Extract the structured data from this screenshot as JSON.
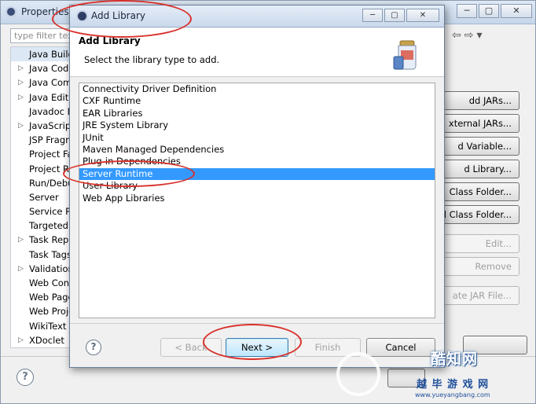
{
  "background_window": {
    "title": "Properties f",
    "filter_placeholder": "type filter tex",
    "tree_items": [
      {
        "label": "Java Build",
        "arrow": ""
      },
      {
        "label": "Java Code",
        "arrow": "▷"
      },
      {
        "label": "Java Comp",
        "arrow": "▷"
      },
      {
        "label": "Java Edito",
        "arrow": "▷"
      },
      {
        "label": "Javadoc Lo",
        "arrow": ""
      },
      {
        "label": "JavaScript",
        "arrow": "▷"
      },
      {
        "label": "JSP Fragm",
        "arrow": ""
      },
      {
        "label": "Project Fa",
        "arrow": ""
      },
      {
        "label": "Project Re",
        "arrow": ""
      },
      {
        "label": "Run/Debu",
        "arrow": ""
      },
      {
        "label": "Server",
        "arrow": ""
      },
      {
        "label": "Service Po",
        "arrow": ""
      },
      {
        "label": "Targeted",
        "arrow": ""
      },
      {
        "label": "Task Repo",
        "arrow": "▷"
      },
      {
        "label": "Task Tags",
        "arrow": ""
      },
      {
        "label": "Validation",
        "arrow": "▷"
      },
      {
        "label": "Web Cont",
        "arrow": ""
      },
      {
        "label": "Web Page",
        "arrow": ""
      },
      {
        "label": "Web Proje",
        "arrow": ""
      },
      {
        "label": "WikiText",
        "arrow": ""
      },
      {
        "label": "XDoclet",
        "arrow": "▷"
      }
    ],
    "side_buttons": [
      {
        "label": "dd JARs...",
        "enabled": true
      },
      {
        "label": "xternal JARs...",
        "enabled": true
      },
      {
        "label": "d Variable...",
        "enabled": true
      },
      {
        "label": "d Library...",
        "enabled": true
      },
      {
        "label": "Class Folder...",
        "enabled": true
      },
      {
        "label": "nal Class Folder...",
        "enabled": true
      },
      {
        "label": "Edit...",
        "enabled": false
      },
      {
        "label": "Remove",
        "enabled": false
      },
      {
        "label": "ate JAR File...",
        "enabled": false
      }
    ],
    "nav_back_icon": "⇦",
    "nav_forward_icon": "⇨",
    "nav_menu_icon": "▾"
  },
  "dialog": {
    "title": "Add Library",
    "header_title": "Add Library",
    "header_desc": "Select the library type to add.",
    "libraries": [
      "Connectivity Driver Definition",
      "CXF Runtime",
      "EAR Libraries",
      "JRE System Library",
      "JUnit",
      "Maven Managed Dependencies",
      "Plug-in Dependencies",
      "Server Runtime",
      "User Library",
      "Web App Libraries"
    ],
    "selected_index": 7,
    "buttons": {
      "back": "< Back",
      "next": "Next >",
      "finish": "Finish",
      "cancel": "Cancel"
    },
    "help_icon": "?",
    "window_controls": {
      "minimize": "─",
      "maximize": "▢",
      "close": "✕"
    }
  },
  "watermark": {
    "name": "酷知网",
    "line2": "越 毕 游 戏 网",
    "url": "www.yueyangbang.com"
  },
  "colors": {
    "selection": "#3399ff",
    "annotation_ring": "#d9302a",
    "next_button": "#bee6fd"
  }
}
